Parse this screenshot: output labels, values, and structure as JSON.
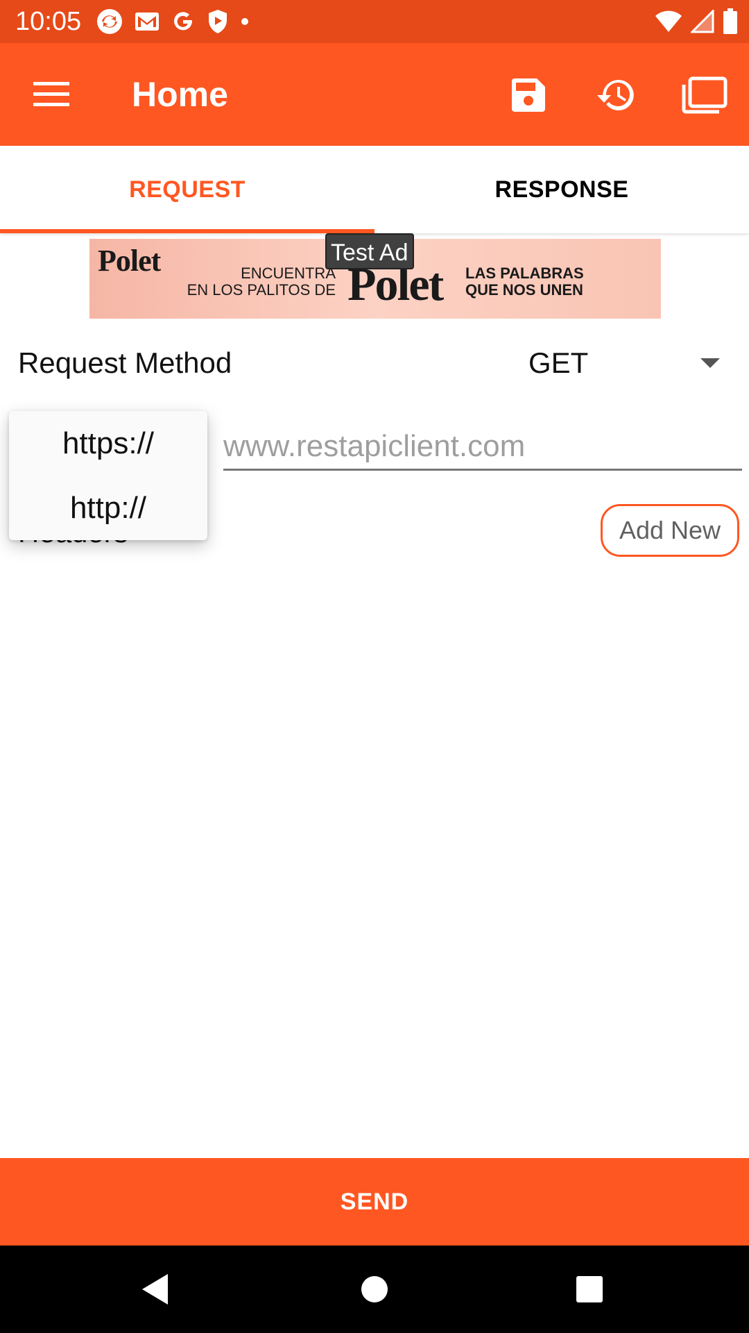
{
  "status_bar": {
    "time": "10:05",
    "left_icons": [
      "sync-icon",
      "gmail-icon",
      "google-icon",
      "shield-icon",
      "dot-icon"
    ],
    "right_icons": [
      "wifi-icon",
      "signal-icon",
      "battery-icon"
    ]
  },
  "toolbar": {
    "title": "Home",
    "icons": [
      "menu-icon",
      "save-icon",
      "history-icon",
      "folder-icon"
    ],
    "background": "#FF5722",
    "status_bar_background": "#E64A19"
  },
  "tabs": [
    {
      "label": "REQUEST",
      "selected": true
    },
    {
      "label": "RESPONSE",
      "selected": false
    }
  ],
  "ad": {
    "test_label": "Test Ad",
    "brand_small": "Polet",
    "text_left_1": "ENCUENTRA",
    "text_left_2": "EN LOS PALITOS DE",
    "brand_big": "Polet",
    "text_right_1": "LAS PALABRAS",
    "text_right_2": "QUE NOS UNEN"
  },
  "request": {
    "method_label": "Request Method",
    "method_value": "GET",
    "url_placeholder": "www.restapiclient.com",
    "url_value": "",
    "headers_label": "Headers",
    "add_new_label": "Add New"
  },
  "protocol_menu": {
    "options": [
      "https://",
      "http://"
    ]
  },
  "send_label": "SEND",
  "nav_icons": [
    "back-icon",
    "home-icon",
    "recents-icon"
  ],
  "accent_color": "#FF5722"
}
